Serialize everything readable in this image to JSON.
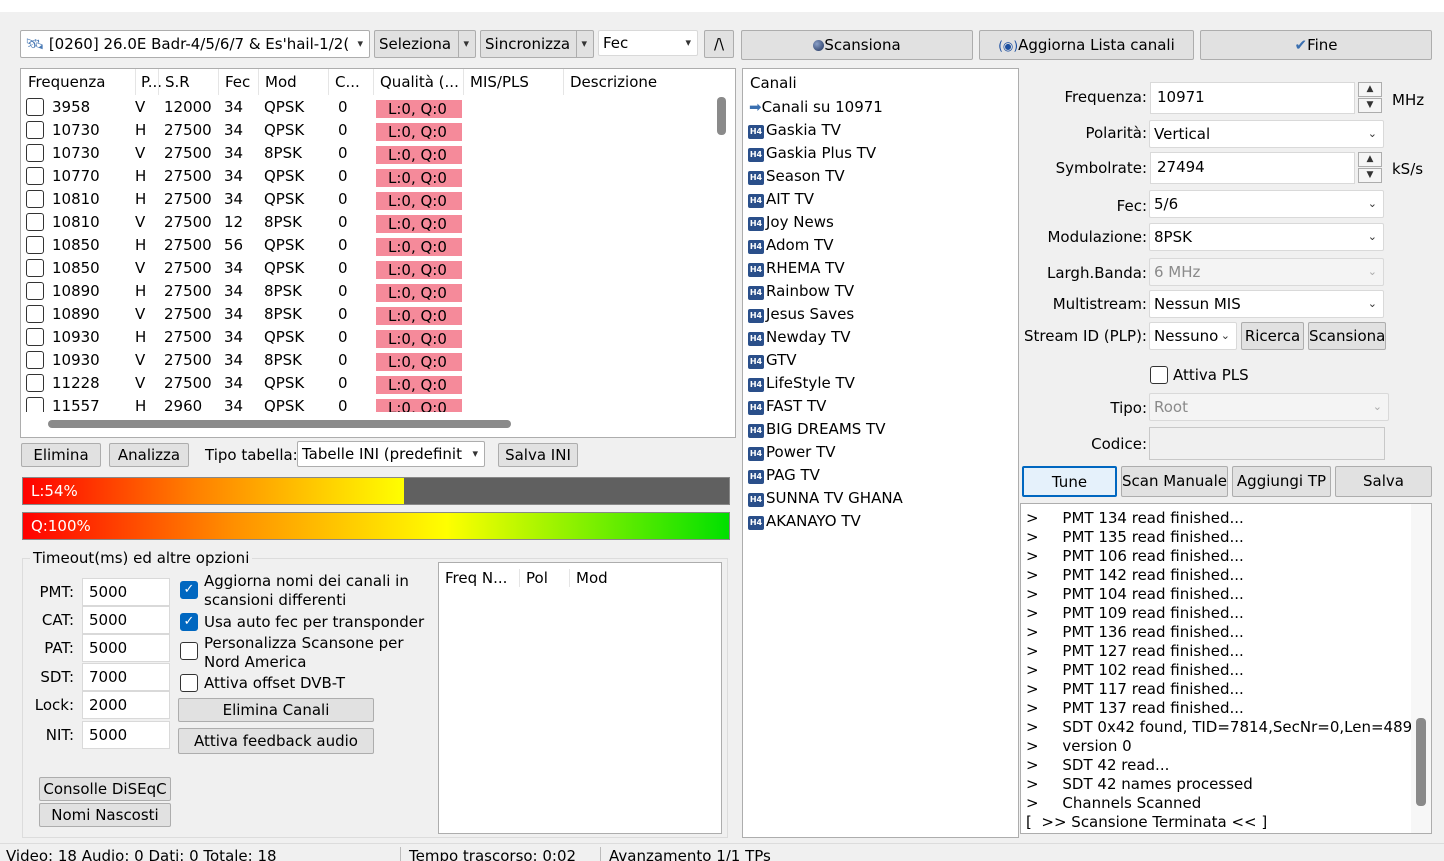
{
  "toolbar": {
    "satellite": "[0260]  26.0E  Badr-4/5/6/7 & Es'hail-1/2(",
    "select": "Seleziona",
    "sync": "Sincronizza",
    "fec": "Fec",
    "up": "/\\",
    "scan": "Scansiona",
    "update": "Aggiorna Lista canali",
    "end": "Fine"
  },
  "tp_table": {
    "headers": [
      "Frequenza",
      "P...",
      "S.R",
      "Fec",
      "Mod",
      "C...",
      "Qualità (...",
      "MIS/PLS",
      "Descrizione"
    ],
    "rows": [
      {
        "freq": "3958",
        "pol": "V",
        "sr": "12000",
        "fec": "34",
        "mod": "QPSK",
        "c": "0",
        "q": "L:0, Q:0"
      },
      {
        "freq": "10730",
        "pol": "H",
        "sr": "27500",
        "fec": "34",
        "mod": "QPSK",
        "c": "0",
        "q": "L:0, Q:0"
      },
      {
        "freq": "10730",
        "pol": "V",
        "sr": "27500",
        "fec": "34",
        "mod": "8PSK",
        "c": "0",
        "q": "L:0, Q:0"
      },
      {
        "freq": "10770",
        "pol": "H",
        "sr": "27500",
        "fec": "34",
        "mod": "QPSK",
        "c": "0",
        "q": "L:0, Q:0"
      },
      {
        "freq": "10810",
        "pol": "H",
        "sr": "27500",
        "fec": "34",
        "mod": "QPSK",
        "c": "0",
        "q": "L:0, Q:0"
      },
      {
        "freq": "10810",
        "pol": "V",
        "sr": "27500",
        "fec": "12",
        "mod": "8PSK",
        "c": "0",
        "q": "L:0, Q:0"
      },
      {
        "freq": "10850",
        "pol": "H",
        "sr": "27500",
        "fec": "56",
        "mod": "QPSK",
        "c": "0",
        "q": "L:0, Q:0"
      },
      {
        "freq": "10850",
        "pol": "V",
        "sr": "27500",
        "fec": "34",
        "mod": "QPSK",
        "c": "0",
        "q": "L:0, Q:0"
      },
      {
        "freq": "10890",
        "pol": "H",
        "sr": "27500",
        "fec": "34",
        "mod": "8PSK",
        "c": "0",
        "q": "L:0, Q:0"
      },
      {
        "freq": "10890",
        "pol": "V",
        "sr": "27500",
        "fec": "34",
        "mod": "8PSK",
        "c": "0",
        "q": "L:0, Q:0"
      },
      {
        "freq": "10930",
        "pol": "H",
        "sr": "27500",
        "fec": "34",
        "mod": "QPSK",
        "c": "0",
        "q": "L:0, Q:0"
      },
      {
        "freq": "10930",
        "pol": "V",
        "sr": "27500",
        "fec": "34",
        "mod": "8PSK",
        "c": "0",
        "q": "L:0, Q:0"
      },
      {
        "freq": "11228",
        "pol": "V",
        "sr": "27500",
        "fec": "34",
        "mod": "QPSK",
        "c": "0",
        "q": "L:0, Q:0"
      },
      {
        "freq": "11557",
        "pol": "H",
        "sr": "2960",
        "fec": "34",
        "mod": "QPSK",
        "c": "0",
        "q": "L:0, Q:0"
      }
    ]
  },
  "table_actions": {
    "delete": "Elimina",
    "analyze": "Analizza",
    "type_label": "Tipo tabella:",
    "type_value": "Tabelle INI (predefinit",
    "save": "Salva INI"
  },
  "level": {
    "label": "L:54%",
    "value": 54
  },
  "quality": {
    "label": "Q:100%",
    "value": 100
  },
  "options": {
    "group_title": "Timeout(ms) ed altre opzioni",
    "timeouts": [
      {
        "label": "PMT:",
        "value": "5000"
      },
      {
        "label": "CAT:",
        "value": "5000"
      },
      {
        "label": "PAT:",
        "value": "5000"
      },
      {
        "label": "SDT:",
        "value": "7000"
      },
      {
        "label": "Lock:",
        "value": "2000"
      },
      {
        "label": "NIT:",
        "value": "5000"
      }
    ],
    "chk_update_names": "Aggiorna nomi dei canali in scansioni differenti",
    "chk_auto_fec": "Usa auto fec per transponder",
    "chk_north_america": "Personalizza Scansone per Nord America",
    "chk_dvbt_offset": "Attiva offset DVB-T",
    "delete_channels": "Elimina Canali",
    "audio_feedback": "Attiva feedback audio",
    "diseqc": "Consolle DiSEqC",
    "hidden_names": "Nomi Nascosti"
  },
  "mini_table": {
    "headers": [
      "Freq N...",
      "Pol",
      "Mod"
    ]
  },
  "channels": {
    "header": "Canali",
    "root": "Canali su 10971",
    "badge": "H4",
    "items": [
      "Gaskia TV",
      "Gaskia Plus TV",
      "Season TV",
      "AIT TV",
      "Joy News",
      "Adom TV",
      "RHEMA TV",
      "Rainbow TV",
      "Jesus Saves",
      "Newday TV",
      "GTV",
      "LifeStyle TV",
      "FAST TV",
      "BIG DREAMS TV",
      "Power TV",
      "PAG TV",
      "SUNNA TV GHANA",
      "AKANAYO TV"
    ]
  },
  "tuner": {
    "freq_label": "Frequenza:",
    "freq_value": "10971",
    "freq_unit": "MHz",
    "pol_label": "Polarità:",
    "pol_value": "Vertical",
    "sr_label": "Symbolrate:",
    "sr_value": "27494",
    "sr_unit": "kS/s",
    "fec_label": "Fec:",
    "fec_value": "5/6",
    "mod_label": "Modulazione:",
    "mod_value": "8PSK",
    "bw_label": "Largh.Banda:",
    "bw_value": "6 MHz",
    "ms_label": "Multistream:",
    "ms_value": "Nessun MIS",
    "sid_label": "Stream ID (PLP):",
    "sid_value": "Nessuno",
    "search": "Ricerca",
    "scan": "Scansiona",
    "pls": "Attiva PLS",
    "type_label": "Tipo:",
    "type_value": "Root",
    "code_label": "Codice:",
    "tune": "Tune",
    "manual": "Scan Manuale",
    "add_tp": "Aggiungi TP",
    "save": "Salva"
  },
  "log": [
    ">     PMT 134 read finished...",
    ">     PMT 135 read finished...",
    ">     PMT 106 read finished...",
    ">     PMT 142 read finished...",
    ">     PMT 104 read finished...",
    ">     PMT 109 read finished...",
    ">     PMT 136 read finished...",
    ">     PMT 127 read finished...",
    ">     PMT 102 read finished...",
    ">     PMT 117 read finished...",
    ">     PMT 137 read finished...",
    ">     SDT 0x42 found, TID=7814,SecNr=0,Len=489",
    ">     version 0",
    ">     SDT 42 read...",
    ">     SDT 42 names processed",
    ">     Channels Scanned",
    "[  >> Scansione Terminata << ]"
  ],
  "status": {
    "counts": "Video: 18  Audio: 0  Dati: 0  Totale: 18",
    "elapsed": "Tempo trascorso: 0:02",
    "progress": "Avanzamento    1/1 TPs"
  },
  "colors": {
    "quality_cell": "#f58a9a",
    "accent": "#0067c0",
    "bar_bg": "#606060"
  }
}
